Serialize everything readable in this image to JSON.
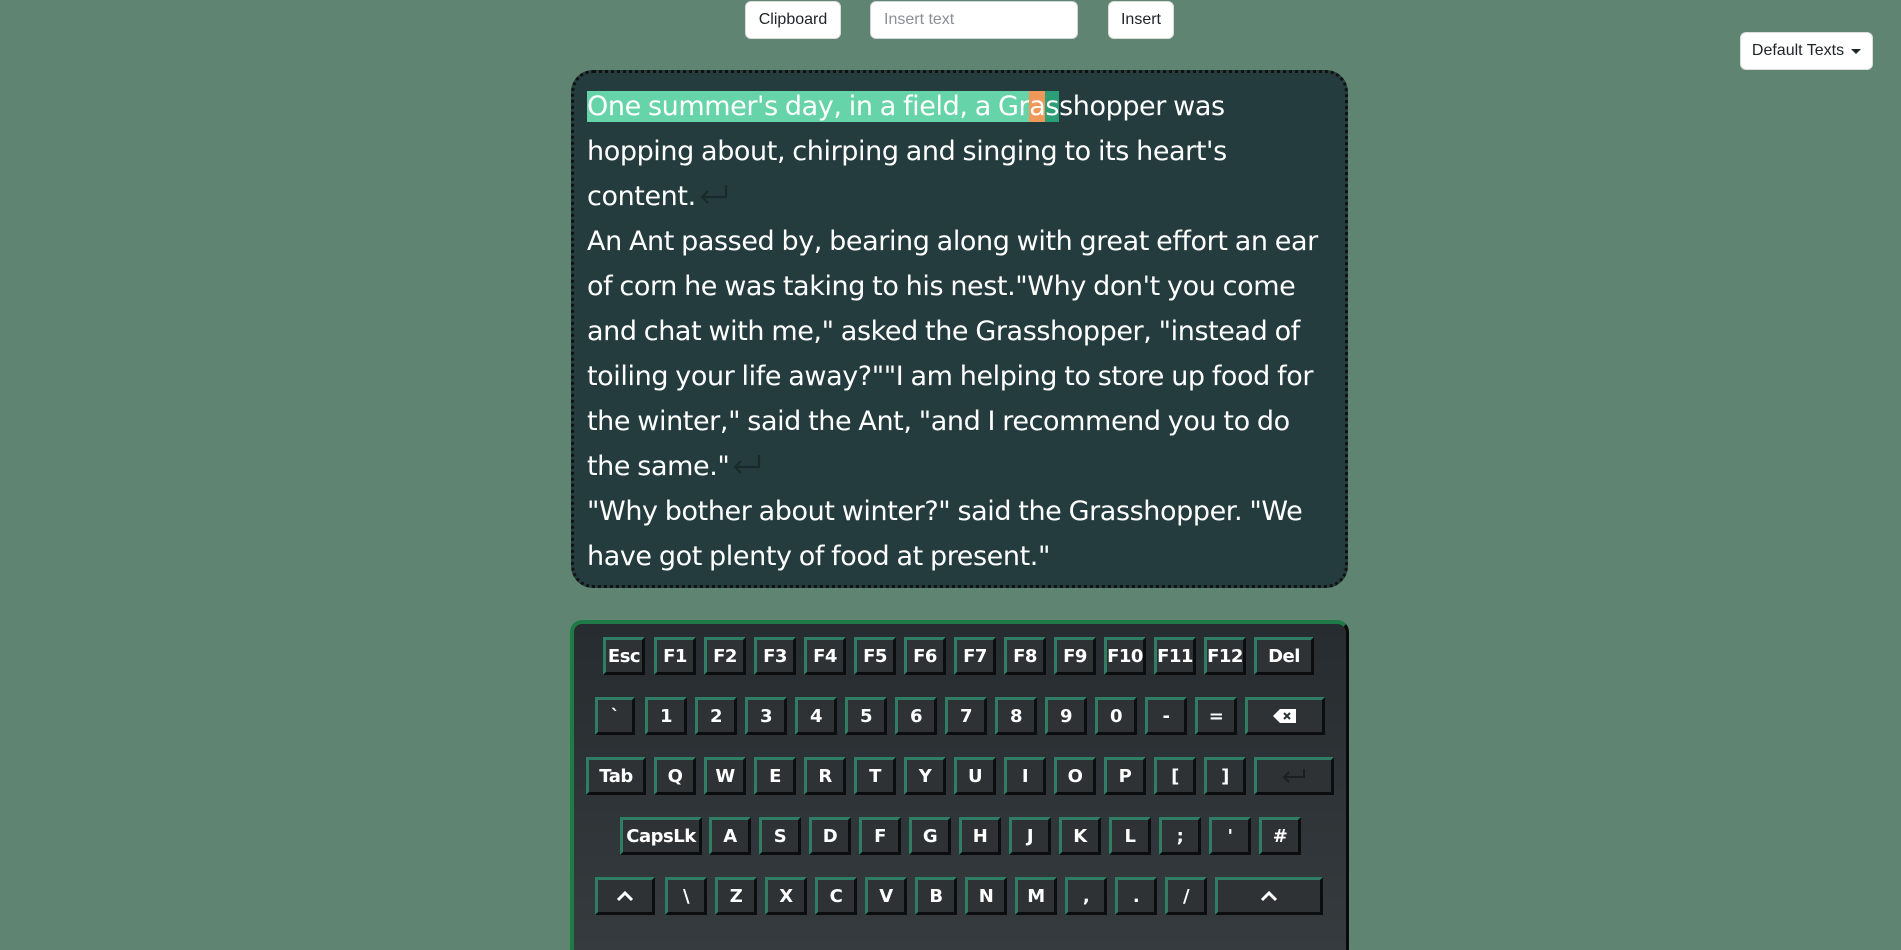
{
  "toolbar": {
    "clipboard_label": "Clipboard",
    "insert_placeholder": "Insert text",
    "insert_value": "",
    "insert_label": "Insert",
    "default_texts_label": "Default Texts"
  },
  "editor": {
    "highlighted_text": "One summer's day, in a field, a Gr",
    "cursor_char": "a",
    "highlight_tail_char": "s",
    "line1_rest": "shopper was hopping about, chirping and singing to its heart's content.",
    "paragraph2": "An Ant passed by, bearing along with great effort an ear of corn he was taking to his nest.\"Why don't you come and chat with me,\" asked the Grasshopper, \"instead of toiling your life away?\"\"I am helping to store up food for the winter,\" said the Ant, \"and I recommend you to do the same.\"",
    "paragraph3": "\"Why bother about winter?\" said the Grasshopper. \"We have got plenty of food at present.\""
  },
  "keyboard": {
    "row1": [
      "Esc",
      "F1",
      "F2",
      "F3",
      "F4",
      "F5",
      "F6",
      "F7",
      "F8",
      "F9",
      "F10",
      "F11",
      "F12",
      "Del"
    ],
    "row2": [
      "`",
      "1",
      "2",
      "3",
      "4",
      "5",
      "6",
      "7",
      "8",
      "9",
      "0",
      "-",
      "=",
      "backspace-icon"
    ],
    "row3": [
      "Tab",
      "Q",
      "W",
      "E",
      "R",
      "T",
      "Y",
      "U",
      "I",
      "O",
      "P",
      "[",
      "]",
      "enter-icon"
    ],
    "row4": [
      "CapsLk",
      "A",
      "S",
      "D",
      "F",
      "G",
      "H",
      "J",
      "K",
      "L",
      ";",
      "'",
      "#"
    ],
    "row5": [
      "^",
      "\\",
      "Z",
      "X",
      "C",
      "V",
      "B",
      "N",
      "M",
      ",",
      ".",
      "/",
      "^"
    ]
  },
  "colors": {
    "background": "#5f8472",
    "editor_bg": "#243c3e",
    "highlight": "#66d4a8",
    "cursor": "#f0985a",
    "key_accent": "#2f7d63"
  }
}
